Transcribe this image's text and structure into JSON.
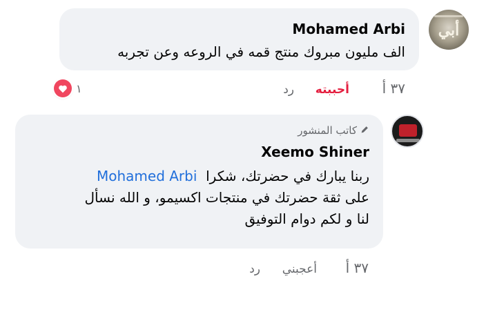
{
  "comments": [
    {
      "author": "Mohamed Arbi",
      "text": "الف مليون مبروك منتج قمه في الروعه وعن تجربه",
      "avatar_glyph": "أبي",
      "time": "٣٧ أ",
      "like_label": "أحببته",
      "reply_label": "رد",
      "reaction_count": "١"
    },
    {
      "author_badge": "كاتب المنشور",
      "author": "Xeemo Shiner",
      "text_line1": "ربنا يبارك في حضرتك، شكرا",
      "mention": "Mohamed Arbi",
      "text_line2": "على ثقة حضرتك في منتجات اكسيمو، و الله نسأل",
      "text_line3": "لنا و لكم دوام التوفيق",
      "time": "٣٧ أ",
      "like_label": "أعجبني",
      "reply_label": "رد"
    }
  ],
  "colors": {
    "bubble": "#f0f2f5",
    "meta": "#65676b",
    "mention": "#216fdb",
    "love": "#e41e3f",
    "heart_badge": "#f0465f"
  }
}
